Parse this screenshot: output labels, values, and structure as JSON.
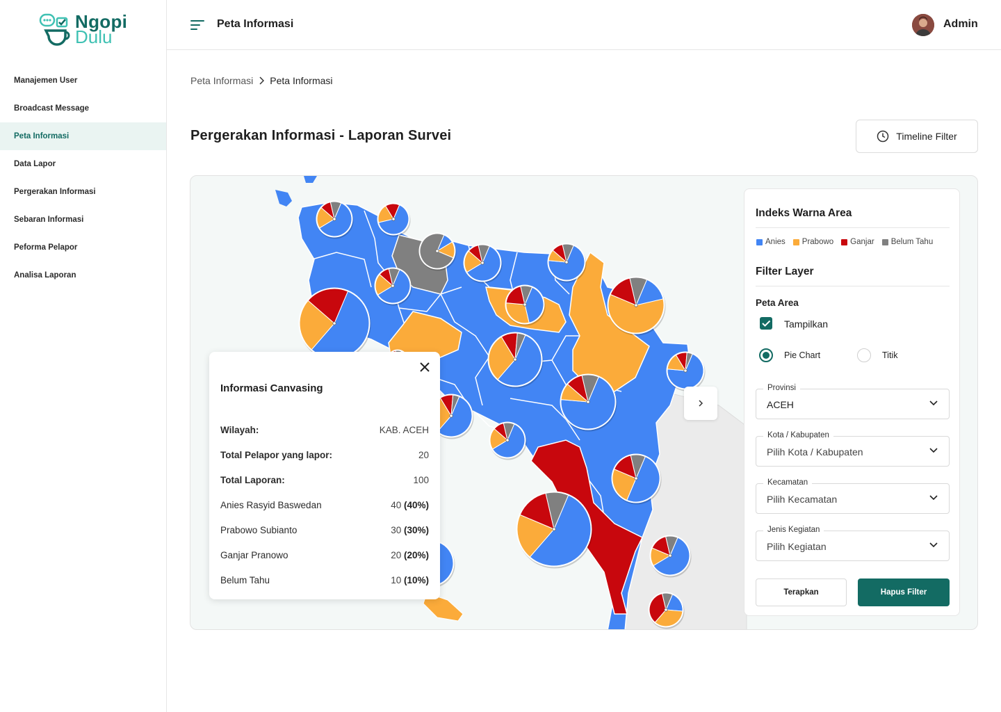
{
  "brand": {
    "line1": "Ngopi",
    "line2": "Dulu"
  },
  "sidebar": {
    "items": [
      {
        "label": "Manajemen User"
      },
      {
        "label": "Broadcast Message"
      },
      {
        "label": "Peta Informasi",
        "active": true
      },
      {
        "label": "Data Lapor"
      },
      {
        "label": "Pergerakan Informasi"
      },
      {
        "label": "Sebaran Informasi"
      },
      {
        "label": "Peforma Pelapor"
      },
      {
        "label": "Analisa Laporan"
      }
    ]
  },
  "header": {
    "title": "Peta Informasi",
    "user": "Admin"
  },
  "breadcrumb": {
    "parent": "Peta Informasi",
    "current": "Peta Informasi"
  },
  "page": {
    "title": "Pergerakan Informasi - Laporan Survei",
    "timeline_label": "Timeline Filter"
  },
  "colors": {
    "anies": "#4285f4",
    "prabowo": "#fbab3a",
    "ganjar": "#c8070d",
    "belum_tahu": "#808080",
    "primary": "#136b63"
  },
  "popup": {
    "title": "Informasi Canvasing",
    "rows": [
      {
        "label": "Wilayah:",
        "value": "KAB. ACEH"
      },
      {
        "label": "Total Pelapor yang lapor:",
        "value": "20"
      },
      {
        "label": "Total Laporan:",
        "value": "100"
      },
      {
        "label": "Anies Rasyid Baswedan",
        "value": "40",
        "pct": "(40%)"
      },
      {
        "label": "Prabowo Subianto",
        "value": "30",
        "pct": "(30%)"
      },
      {
        "label": "Ganjar Pranowo",
        "value": "20",
        "pct": "(20%)"
      },
      {
        "label": "Belum Tahu",
        "value": "10",
        "pct": "(10%)"
      }
    ]
  },
  "panel": {
    "legend_title": "Indeks Warna Area",
    "legend": [
      {
        "label": "Anies",
        "color": "#4285f4"
      },
      {
        "label": "Prabowo",
        "color": "#fbab3a"
      },
      {
        "label": "Ganjar",
        "color": "#c8070d"
      },
      {
        "label": "Belum Tahu",
        "color": "#808080"
      }
    ],
    "filter_title": "Filter Layer",
    "area_title": "Peta Area",
    "show_label": "Tampilkan",
    "radio_pie": "Pie Chart",
    "radio_point": "Titik",
    "fields": [
      {
        "label": "Provinsi",
        "value": "ACEH"
      },
      {
        "label": "Kota / Kabupaten",
        "value": "Pilih Kota / Kabupaten"
      },
      {
        "label": "Kecamatan",
        "value": "Pilih Kecamatan"
      },
      {
        "label": "Jenis Kegiatan",
        "value": "Pilih Kegiatan"
      }
    ],
    "apply": "Terapkan",
    "clear": "Hapus Filter"
  },
  "map_pies": [
    {
      "values": [
        60,
        20,
        10,
        10
      ]
    },
    {
      "values": [
        65,
        20,
        15,
        0
      ]
    },
    {
      "values": [
        10,
        15,
        0,
        75
      ]
    },
    {
      "values": [
        60,
        20,
        10,
        10
      ]
    },
    {
      "values": [
        70,
        10,
        10,
        10
      ]
    },
    {
      "values": [
        60,
        20,
        10,
        10
      ]
    },
    {
      "values": [
        40,
        30,
        20,
        10
      ]
    },
    {
      "values": [
        55,
        25,
        20,
        0
      ]
    },
    {
      "values": [
        15,
        60,
        15,
        10
      ]
    },
    {
      "values": [
        55,
        30,
        10,
        5
      ]
    },
    {
      "values": [
        70,
        10,
        10,
        10
      ]
    },
    {
      "values": [
        70,
        15,
        10,
        5
      ]
    },
    {
      "values": [
        55,
        30,
        10,
        5
      ]
    },
    {
      "values": [
        60,
        20,
        10,
        10
      ]
    },
    {
      "values": [
        50,
        25,
        15,
        10
      ]
    },
    {
      "values": [
        55,
        20,
        15,
        10
      ]
    },
    {
      "values": [
        60,
        15,
        15,
        10
      ]
    },
    {
      "values": [
        20,
        35,
        35,
        10
      ]
    },
    {
      "values": [
        55,
        20,
        15,
        10
      ]
    },
    {
      "values": [
        60,
        20,
        10,
        10
      ]
    }
  ]
}
